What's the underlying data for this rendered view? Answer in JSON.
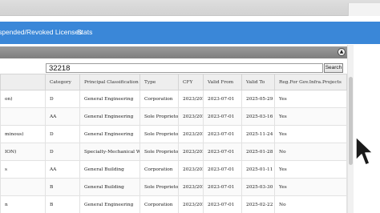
{
  "nav": {
    "links": [
      "spended/Revoked Licenses",
      "Stats"
    ]
  },
  "search": {
    "value": "32218",
    "button_label": "Search"
  },
  "table": {
    "headers": [
      "",
      "Category",
      "Principal Classification",
      "Type",
      "CFY",
      "Valid From",
      "Valid To",
      "Reg.For Gov.Infra.Projects"
    ],
    "rows": [
      [
        "on)",
        "D",
        "General Engineering",
        "Corporation",
        "2023/2024",
        "2023-07-01",
        "2025-05-29",
        "Yes"
      ],
      [
        "",
        "AA",
        "General Engineering",
        "Sole Proprietorship",
        "2023/2024",
        "2023-07-01",
        "2025-03-16",
        "Yes"
      ],
      [
        "minous)",
        "D",
        "General Engineering",
        "Sole Proprietorship",
        "2023/2024",
        "2023-07-01",
        "2025-11-24",
        "Yes"
      ],
      [
        "ION)",
        "D",
        "Specialty-Mechanical Work",
        "Sole Proprietorship",
        "2023/2024",
        "2023-07-01",
        "2025-01-28",
        "No"
      ],
      [
        "s",
        "AA",
        "General Building",
        "Corporation",
        "2023/2024",
        "2023-07-01",
        "2025-01-11",
        "Yes"
      ],
      [
        "",
        "B",
        "General Building",
        "Sole Proprietorship",
        "2023/2024",
        "2023-07-01",
        "2025-03-30",
        "Yes"
      ],
      [
        "n",
        "B",
        "General Engineering",
        "Corporation",
        "2023/2024",
        "2023-07-01",
        "2025-02-22",
        "No"
      ]
    ]
  },
  "colors": {
    "navbar": "#3a87d8",
    "panel_header": "#8a8a8a"
  },
  "icons": {
    "collapse": "chevron-up-icon",
    "cursor": "mouse-pointer-icon"
  }
}
